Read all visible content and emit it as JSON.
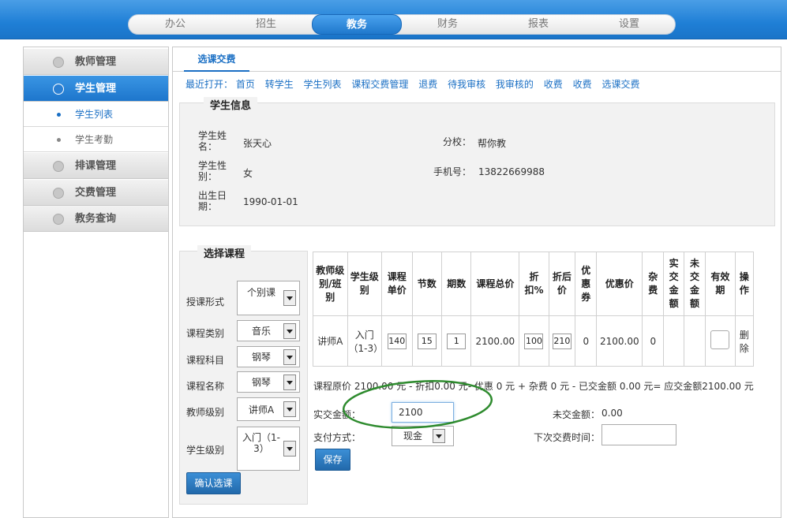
{
  "topnav": {
    "items": [
      {
        "label": "办公",
        "active": false
      },
      {
        "label": "招生",
        "active": false
      },
      {
        "label": "教务",
        "active": true
      },
      {
        "label": "财务",
        "active": false
      },
      {
        "label": "报表",
        "active": false
      },
      {
        "label": "设置",
        "active": false
      }
    ]
  },
  "sidebar": {
    "items": [
      {
        "label": "教师管理",
        "type": "group",
        "active": false,
        "icon": "teacher-icon"
      },
      {
        "label": "学生管理",
        "type": "group",
        "active": true,
        "icon": "heart-icon"
      },
      {
        "label": "学生列表",
        "type": "sub",
        "active": true
      },
      {
        "label": "学生考勤",
        "type": "sub",
        "active": false
      },
      {
        "label": "排课管理",
        "type": "group",
        "active": false,
        "icon": "schedule-icon"
      },
      {
        "label": "交费管理",
        "type": "group",
        "active": false,
        "icon": "payment-icon"
      },
      {
        "label": "教务查询",
        "type": "group",
        "active": false,
        "icon": "query-icon"
      }
    ]
  },
  "tab": {
    "label": "选课交费"
  },
  "recent": {
    "label": "最近打开：",
    "links": [
      "首页",
      "转学生",
      "学生列表",
      "课程交费管理",
      "退费",
      "待我审核",
      "我审核的",
      "收费",
      "收费",
      "选课交费"
    ]
  },
  "student_info": {
    "title": "学生信息",
    "name_label": "学生姓名：",
    "name": "张天心",
    "branch_label": "分校：",
    "branch": "帮你教",
    "gender_label": "学生性别：",
    "gender": "女",
    "phone_label": "手机号：",
    "phone": "13822669988",
    "birth_label": "出生日期：",
    "birth": "1990-01-01"
  },
  "course_select": {
    "title": "选择课程",
    "fields": [
      {
        "label": "授课形式",
        "value": "个别课"
      },
      {
        "label": "课程类别",
        "value": "音乐"
      },
      {
        "label": "课程科目",
        "value": "钢琴"
      },
      {
        "label": "课程名称",
        "value": "钢琴"
      },
      {
        "label": "教师级别",
        "value": "讲师A"
      },
      {
        "label": "学生级别",
        "value": "入门（1-3）"
      }
    ],
    "confirm_label": "确认选课"
  },
  "table": {
    "headers": [
      "教师级别/班别",
      "学生级别",
      "课程单价",
      "节数",
      "期数",
      "课程总价",
      "折扣%",
      "折后价",
      "优惠券",
      "优惠价",
      "杂费",
      "实交金额",
      "未交金额",
      "有效期",
      "操作"
    ],
    "row": {
      "teacher_level": "讲师A",
      "student_level": "入门（1-3）",
      "unit_price": "140",
      "lessons": "15",
      "periods": "1",
      "total": "2100.00",
      "discount": "100",
      "discounted": "210",
      "coupon": "0",
      "final_price": "2100.00",
      "misc": "0",
      "paid": "",
      "unpaid": "",
      "action": "删除"
    }
  },
  "summary": "课程原价 2100.00 元 - 折扣0.00 元- 优惠 0 元 + 杂费 0 元 - 已交金额 0.00 元= 应交金额2100.00 元",
  "payment": {
    "amount_label": "实交金额：",
    "amount": "2100",
    "unpaid_label": "未交金额：",
    "unpaid": "0.00",
    "method_label": "支付方式：",
    "method": "现金",
    "next_label": "下次交费时间：",
    "next_value": "",
    "save_label": "保存"
  },
  "colors": {
    "accent": "#1a6fc4",
    "annotation": "#2e8b2e"
  }
}
